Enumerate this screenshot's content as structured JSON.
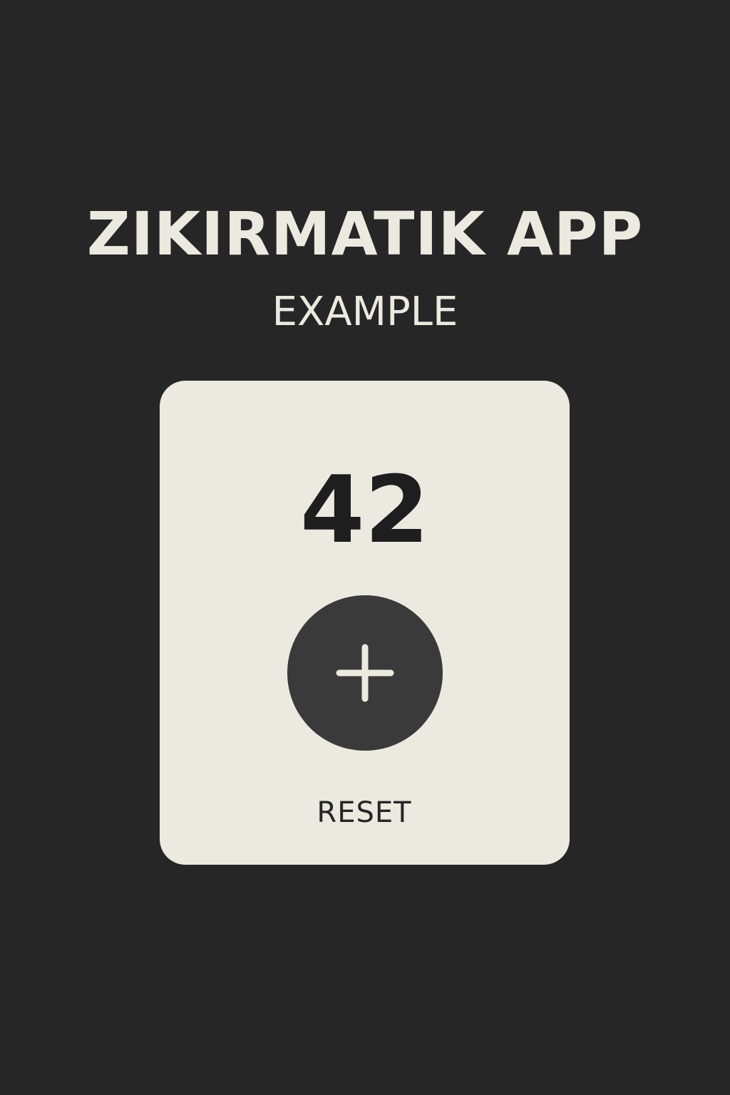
{
  "header": {
    "title": "ZIKIRMATIK APP",
    "subtitle": "EXAMPLE"
  },
  "counter": {
    "value": "42",
    "increment_icon": "plus-icon",
    "reset_label": "RESET"
  },
  "colors": {
    "background": "#262626",
    "card": "#ece9e0",
    "button": "#3a3a3a",
    "text_light": "#ece9e0",
    "text_dark": "#1e1e1e"
  }
}
